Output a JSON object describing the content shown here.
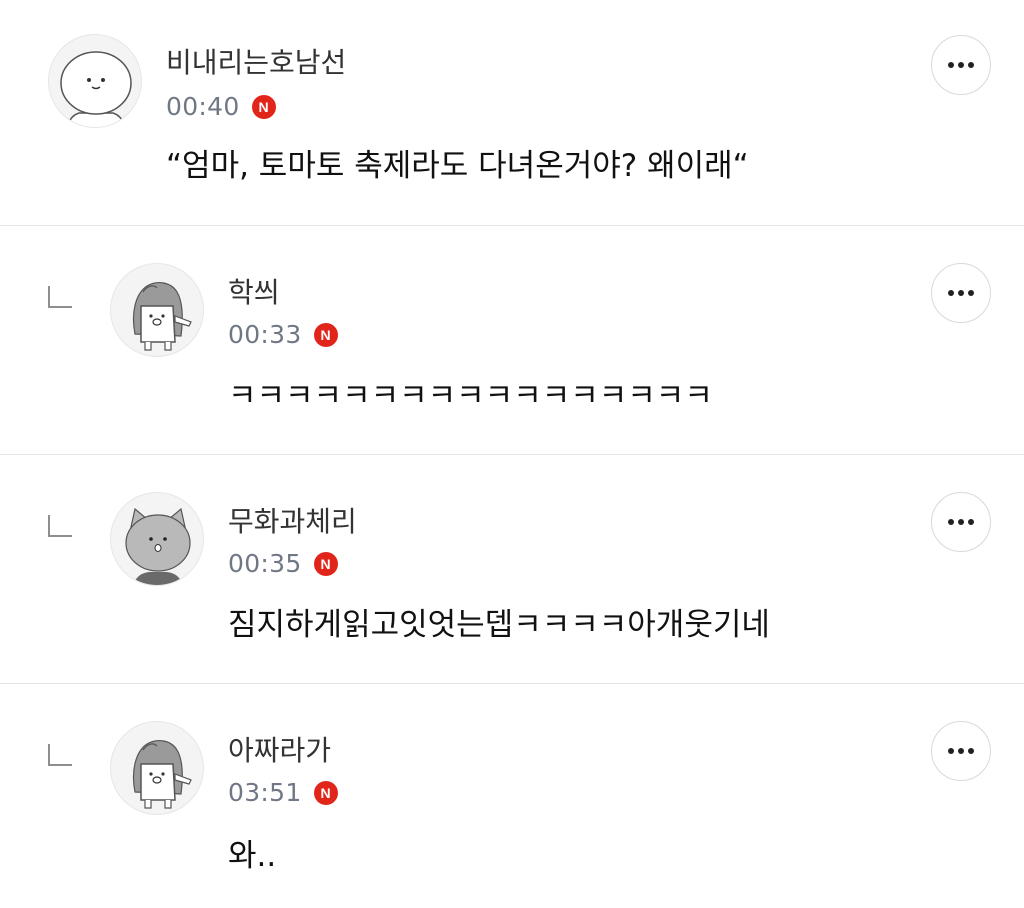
{
  "comments": [
    {
      "nickname": "비내리는호남선",
      "time": "00:40",
      "badge": "N",
      "text": "“엄마, 토마토 축제라도 다녀온거야? 왜이래“",
      "avatar_icon": "white-round-character-icon",
      "is_reply": false
    },
    {
      "nickname": "학씌",
      "time": "00:33",
      "badge": "N",
      "text": "ㅋㅋㅋㅋㅋㅋㅋㅋㅋㅋㅋㅋㅋㅋㅋㅋㅋ",
      "avatar_icon": "hooded-character-icon",
      "is_reply": true
    },
    {
      "nickname": "무화과체리",
      "time": "00:35",
      "badge": "N",
      "text": "짐지하게읽고잇엇는뎁ㅋㅋㅋㅋ아개웃기네",
      "avatar_icon": "gray-cat-character-icon",
      "is_reply": true
    },
    {
      "nickname": "아짜라가",
      "time": "03:51",
      "badge": "N",
      "text": "와..",
      "avatar_icon": "hooded-character-icon",
      "is_reply": true
    }
  ],
  "colors": {
    "badge": "#e1251b",
    "time": "#707885",
    "divider": "#e4e4e4"
  },
  "icons": {
    "more": "more-horizontal-icon",
    "reply": "reply-indent-icon",
    "new": "new-badge-icon"
  }
}
